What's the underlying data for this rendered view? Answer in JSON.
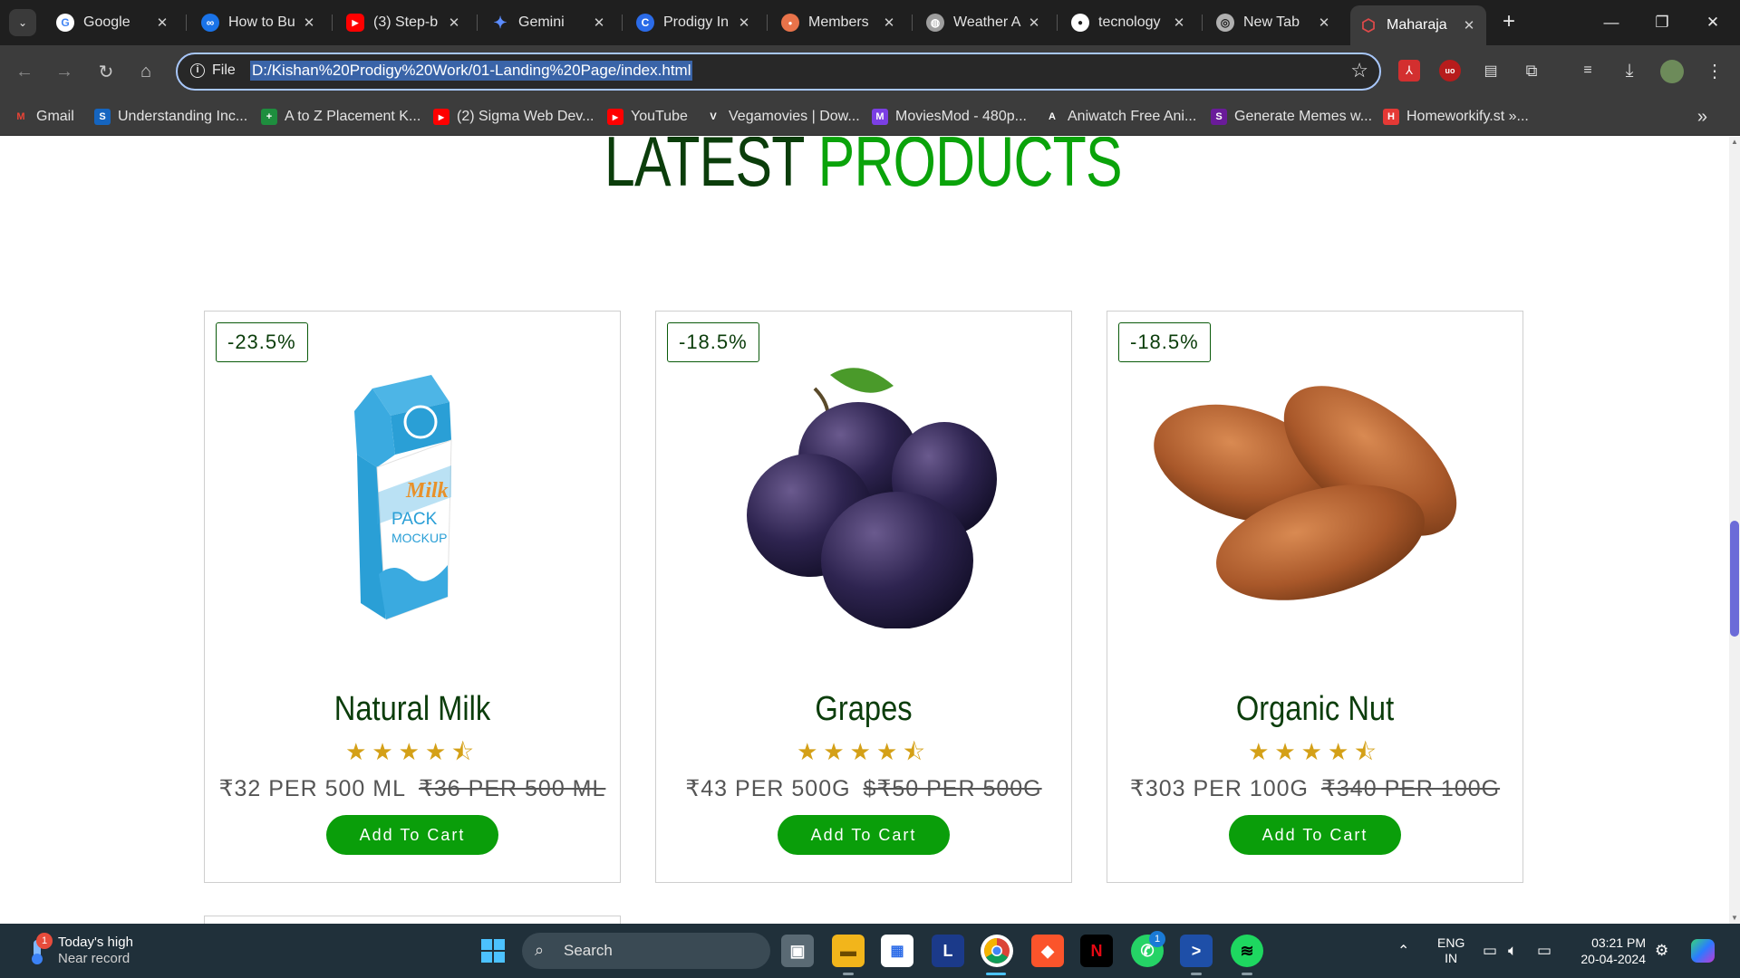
{
  "browser": {
    "tabs": [
      {
        "title": "Google",
        "favicon_color": "#ffffff",
        "favicon_text": "G",
        "favicon_text_color": "#4285f4"
      },
      {
        "title": "How to Bu",
        "favicon_color": "#1a73e8",
        "favicon_text": "∞",
        "favicon_text_color": "#ffffff"
      },
      {
        "title": "(3) Step-b",
        "favicon_color": "#ff0000",
        "favicon_text": "▶",
        "favicon_text_color": "#ffffff"
      },
      {
        "title": "Gemini",
        "favicon_color": "#1f1f1f",
        "favicon_text": "✦",
        "favicon_text_color": "#5b8cff"
      },
      {
        "title": "Prodigy In",
        "favicon_color": "#2b6be8",
        "favicon_text": "C",
        "favicon_text_color": "#ffffff"
      },
      {
        "title": "Members",
        "favicon_color": "#e8734a",
        "favicon_text": "●",
        "favicon_text_color": "#ffffff"
      },
      {
        "title": "Weather A",
        "favicon_color": "#9e9e9e",
        "favicon_text": "◍",
        "favicon_text_color": "#ffffff"
      },
      {
        "title": "tecnology",
        "favicon_color": "#ffffff",
        "favicon_text": "●",
        "favicon_text_color": "#1f1f1f"
      },
      {
        "title": "New Tab",
        "favicon_color": "#b0b0b0",
        "favicon_text": "◎",
        "favicon_text_color": "#1f1f1f"
      },
      {
        "title": "Maharaja",
        "favicon_color": "#c0392b",
        "favicon_text": "⬡",
        "favicon_text_color": "#ffffff"
      }
    ],
    "close_glyph": "✕",
    "new_tab_glyph": "+",
    "omnibox": {
      "scheme_label": "File",
      "url": "D:/Kishan%20Prodigy%20Work/01-Landing%20Page/index.html"
    },
    "bookmarks": [
      {
        "label": "Gmail",
        "color": "#ea4335",
        "glyph": "M"
      },
      {
        "label": "Understanding Inc...",
        "color": "#1565c0",
        "glyph": "S"
      },
      {
        "label": "A to Z Placement K...",
        "color": "#1e8e3e",
        "glyph": "+"
      },
      {
        "label": "(2) Sigma Web Dev...",
        "color": "#ff0000",
        "glyph": "▶"
      },
      {
        "label": "YouTube",
        "color": "#ff0000",
        "glyph": "▶"
      },
      {
        "label": "Vegamovies | Dow...",
        "color": "#3c3c3c",
        "glyph": "V"
      },
      {
        "label": "MoviesMod - 480p...",
        "color": "#7b3fe4",
        "glyph": "M"
      },
      {
        "label": "Aniwatch Free Ani...",
        "color": "#3c3c3c",
        "glyph": "A"
      },
      {
        "label": "Generate Memes w...",
        "color": "#6a1b9a",
        "glyph": "S"
      },
      {
        "label": "Homeworkify.st »...",
        "color": "#e53935",
        "glyph": "H"
      }
    ]
  },
  "page": {
    "section_title_part1": "LATEST",
    "section_title_part2": "PRODUCTS",
    "products": [
      {
        "discount": "-23.5%",
        "name": "Natural Milk",
        "stars": "★★★★⯪",
        "rating": 4.5,
        "price": "₹32 PER 500 ML",
        "old_price": "₹36 PER 500 ML",
        "button": "Add To Cart"
      },
      {
        "discount": "-18.5%",
        "name": "Grapes",
        "stars": "★★★★⯪",
        "rating": 4.5,
        "price": "₹43 PER 500G",
        "old_price": "$₹50 PER 500G",
        "button": "Add To Cart"
      },
      {
        "discount": "-18.5%",
        "name": "Organic Nut",
        "stars": "★★★★⯪",
        "rating": 4.5,
        "price": "₹303 PER 100G",
        "old_price": "₹340 PER 100G",
        "button": "Add To Cart"
      }
    ],
    "milk_box_text": {
      "brand": "Milk",
      "line1": "PACK",
      "line2": "MOCKUP"
    }
  },
  "taskbar": {
    "weather_title": "Today's high",
    "weather_sub": "Near record",
    "weather_badge": "1",
    "search_label": "Search",
    "language": "ENG",
    "region": "IN",
    "time": "03:21 PM",
    "date": "20-04-2024",
    "whatsapp_badge": "1",
    "colors": {
      "taskbar_bg": "#20303a",
      "accent_green": "#0a9e0a",
      "title_dark_green": "#0b3d0b",
      "star_gold": "#d4a017"
    }
  }
}
